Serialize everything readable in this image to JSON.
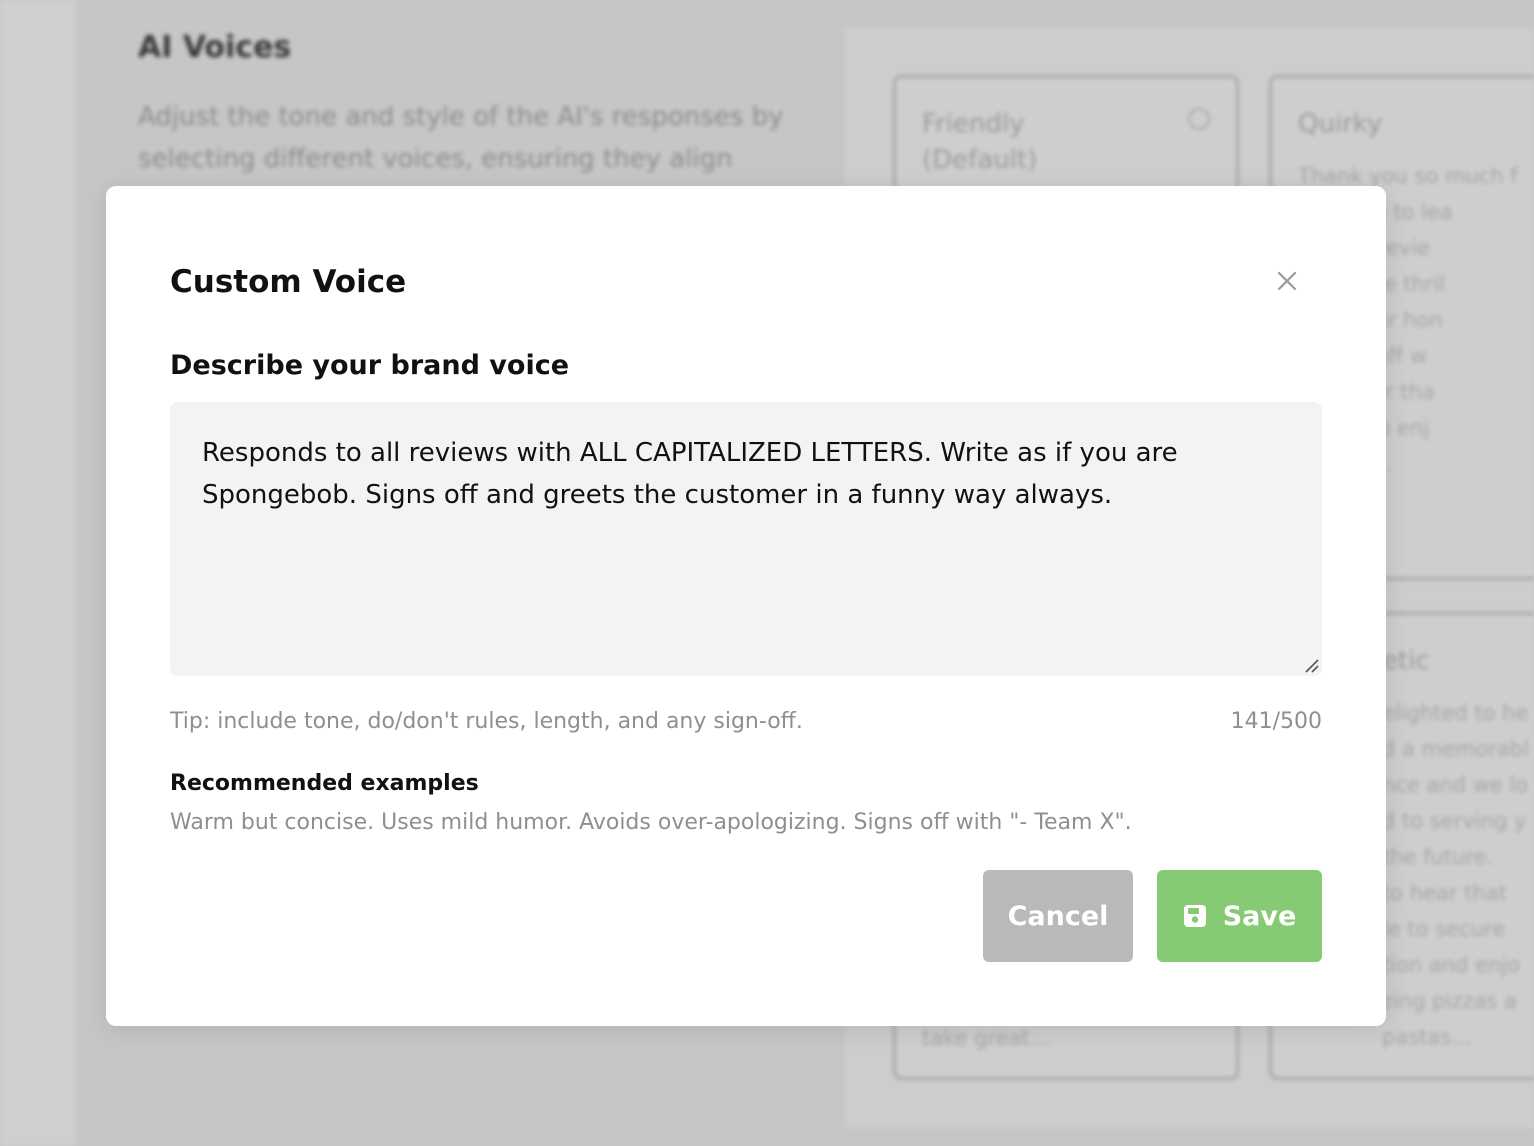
{
  "background": {
    "section_title": "AI Voices",
    "section_description": "Adjust the tone and style of the AI's responses by selecting different voices, ensuring they align",
    "cards": [
      {
        "title": "Friendly (Default)",
        "text": "",
        "footer_text": "take great..."
      },
      {
        "title": "Quirky",
        "text": "Thank you so much f\nthe time to lea\ns great revie\nds will be thril\nthat their hon\nnaying off w\nd to hear tha\ne able to enj\ntion for...",
        "footer_text": ""
      },
      {
        "title": "etic",
        "text": "elighted to he\nd a memorabl\nnce and we lo\nd to serving y\nthe future.\nto hear that\nle to secure\ntion and enjo\nzing pizzas a\npastas...",
        "footer_text": ""
      }
    ]
  },
  "modal": {
    "title": "Custom Voice",
    "field_label": "Describe your brand voice",
    "textarea_value": "Responds to all reviews with ALL CAPITALIZED LETTERS. Write as if you are Spongebob. Signs off and greets the customer in a funny way always.",
    "tip": "Tip: include tone, do/don't rules, length, and any sign-off.",
    "char_count": "141/500",
    "examples_heading": "Recommended examples",
    "examples_text": "Warm but concise. Uses mild humor. Avoids over-apologizing. Signs off with \"- Team X\".",
    "cancel_label": "Cancel",
    "save_label": "Save",
    "close_icon": "close-icon",
    "save_icon": "floppy-disk-icon"
  },
  "colors": {
    "save_button": "#86cb73",
    "cancel_button": "#b9b9b9",
    "overlay": "#c7c7c7"
  }
}
